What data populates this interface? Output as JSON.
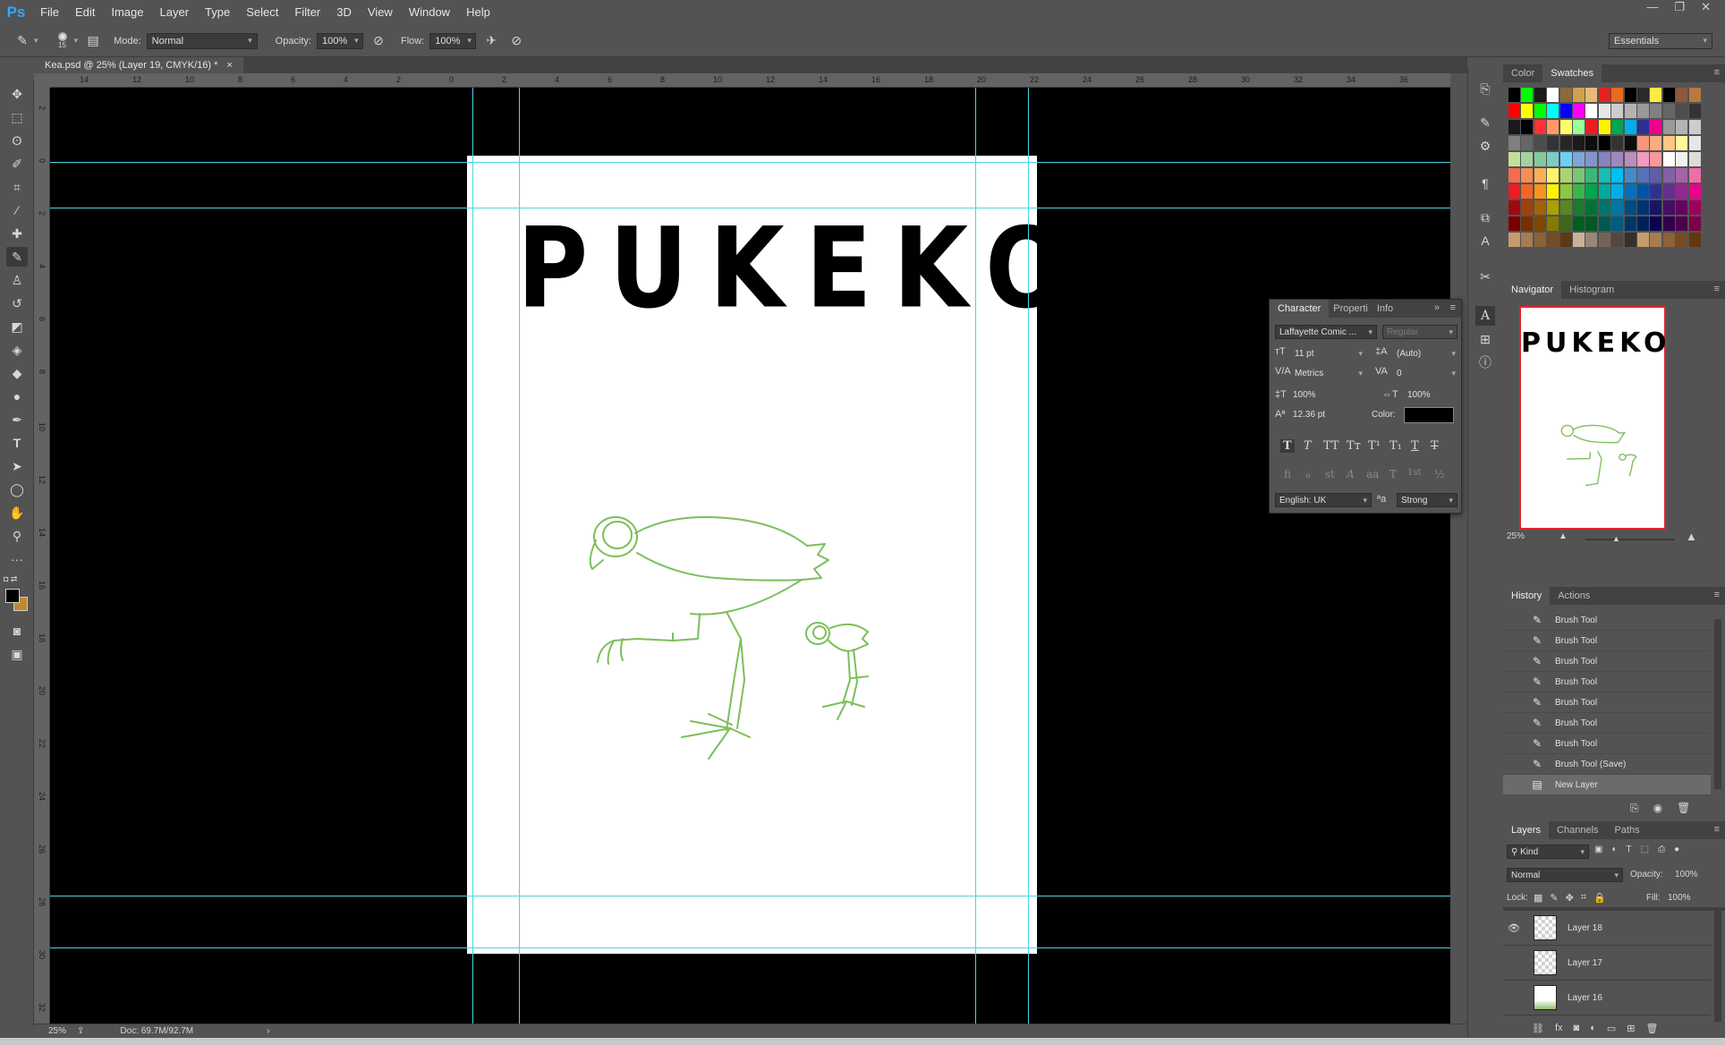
{
  "menubar": {
    "logo": "Ps",
    "items": [
      "File",
      "Edit",
      "Image",
      "Layer",
      "Type",
      "Select",
      "Filter",
      "3D",
      "View",
      "Window",
      "Help"
    ]
  },
  "options": {
    "brush_size": "15",
    "mode_label": "Mode:",
    "mode_value": "Normal",
    "opacity_label": "Opacity:",
    "opacity_value": "100%",
    "flow_label": "Flow:",
    "flow_value": "100%",
    "workspace": "Essentials"
  },
  "document": {
    "tab_title": "Kea.psd @ 25% (Layer 19, CMYK/16) *",
    "headline": "PUKEKO",
    "illustration": "green pukeko sketch",
    "guide_color": "#4fd3e6",
    "sketch_color": "#7cbf5a"
  },
  "rulers": {
    "top": [
      "14",
      "12",
      "10",
      "8",
      "6",
      "4",
      "2",
      "0",
      "2",
      "4",
      "6",
      "8",
      "10",
      "12",
      "14",
      "16",
      "18",
      "20",
      "22",
      "24",
      "26",
      "28",
      "30",
      "32",
      "34",
      "36"
    ],
    "left": [
      "2",
      "0",
      "2",
      "4",
      "6",
      "8",
      "10",
      "12",
      "14",
      "16",
      "18",
      "20",
      "22",
      "24",
      "26",
      "28",
      "30",
      "32"
    ]
  },
  "statusbar": {
    "zoom": "25%",
    "doc_info": "Doc: 69.7M/92.7M"
  },
  "panels": {
    "color_tabs": [
      "Color",
      "Swatches"
    ],
    "navigator_tabs": [
      "Navigator",
      "Histogram"
    ],
    "navigator_zoom": "25%",
    "history_tabs": [
      "History",
      "Actions"
    ],
    "history_items": [
      "Brush Tool",
      "Brush Tool",
      "Brush Tool",
      "Brush Tool",
      "Brush Tool",
      "Brush Tool",
      "Brush Tool",
      "Brush Tool (Save)",
      "New Layer"
    ],
    "layers_tabs": [
      "Layers",
      "Channels",
      "Paths"
    ],
    "layers_filter": "Kind",
    "blend_mode": "Normal",
    "opacity_label": "Opacity:",
    "opacity_value": "100%",
    "lock_label": "Lock:",
    "fill_label": "Fill:",
    "fill_value": "100%",
    "layers": [
      {
        "name": "Layer 18",
        "visible": true
      },
      {
        "name": "Layer 17",
        "visible": false
      },
      {
        "name": "Layer 16",
        "visible": false
      }
    ]
  },
  "character": {
    "tabs": [
      "Character",
      "Properti",
      "Info"
    ],
    "font_family": "Laffayette Comic ...",
    "font_style": "Regular",
    "size": "11 pt",
    "leading": "(Auto)",
    "kerning": "Metrics",
    "tracking": "0",
    "vscale": "100%",
    "hscale": "100%",
    "baseline": "12.36 pt",
    "color_label": "Color:",
    "color_value": "#000000",
    "language": "English: UK",
    "antialias": "Strong",
    "style_buttons": [
      "T",
      "T",
      "TT",
      "Tт",
      "T¹",
      "T₁",
      "T",
      "T"
    ],
    "opentype_buttons": [
      "fi",
      "ℴ",
      "st",
      "A",
      "aa",
      "T",
      "1st",
      "½"
    ]
  },
  "swatch_colors": [
    [
      "#000000",
      "#00ff00",
      "#1a1a1a",
      "#ffffff",
      "#8c6a3a",
      "#d2a04c",
      "#e8b878",
      "#e62020",
      "#e66b1e",
      "#000000",
      "#2a2a2a",
      "#ffe84a",
      "#000000",
      "#8c5a3a",
      "#b87840"
    ],
    [
      "#ff0000",
      "#ffff00",
      "#00ff00",
      "#00ffff",
      "#0000ff",
      "#ff00ff",
      "#ffffff",
      "#e6e6e6",
      "#cccccc",
      "#b3b3b3",
      "#999999",
      "#808080",
      "#666666",
      "#4d4d4d",
      "#333333"
    ],
    [
      "#1a1a1a",
      "#000000",
      "#ff3333",
      "#ff9966",
      "#ffff66",
      "#99ff99",
      "#ed1c24",
      "#fff200",
      "#00a651",
      "#00aeef",
      "#2e3192",
      "#ec008c",
      "#999999",
      "#b3b3b3",
      "#cccccc"
    ],
    [
      "#808080",
      "#666666",
      "#4d4d4d",
      "#333333",
      "#262626",
      "#1a1a1a",
      "#0d0d0d",
      "#000000",
      "#333333",
      "#0d0d0d",
      "#f7977a",
      "#f9ad81",
      "#fdc68a",
      "#fff79a",
      "#e6e6e6"
    ],
    [
      "#c4df9b",
      "#a3d39c",
      "#82ca9d",
      "#7bcdc8",
      "#6ecff6",
      "#7ea7d8",
      "#8493ca",
      "#8882be",
      "#a187be",
      "#bc8dbf",
      "#f49ac2",
      "#f6989d",
      "#ffffff",
      "#f0f0f0",
      "#dcdcdc"
    ],
    [
      "#f26c4f",
      "#f68e55",
      "#fbaf5c",
      "#fff467",
      "#acd372",
      "#7cc576",
      "#3bb878",
      "#1abbb4",
      "#00bff3",
      "#438ccb",
      "#5574b9",
      "#605ca8",
      "#855fa8",
      "#a763a8",
      "#f06ea9"
    ],
    [
      "#ed1c24",
      "#f26522",
      "#f7941d",
      "#fff200",
      "#8dc63f",
      "#39b54a",
      "#00a651",
      "#00a99d",
      "#00aeef",
      "#0072bc",
      "#0054a6",
      "#2e3192",
      "#662d91",
      "#92278f",
      "#ec008c"
    ],
    [
      "#9e0b0f",
      "#a0410d",
      "#a3620a",
      "#aba000",
      "#598527",
      "#1a7b30",
      "#007236",
      "#00746b",
      "#0076a3",
      "#004b80",
      "#003471",
      "#1b1464",
      "#440e62",
      "#630460",
      "#9e005d"
    ],
    [
      "#790000",
      "#7b2e00",
      "#7d4900",
      "#827b00",
      "#406618",
      "#005e20",
      "#005826",
      "#005952",
      "#005b7f",
      "#003663",
      "#002157",
      "#0d004c",
      "#32004b",
      "#4b0049",
      "#7b0046"
    ],
    [
      "#c69c6d",
      "#a67c52",
      "#8c6239",
      "#754c24",
      "#603813",
      "#c7b299",
      "#998675",
      "#736357",
      "#534741",
      "#37302a",
      "#c69c6d",
      "#a67c52",
      "#8c6239",
      "#754c24",
      "#603813"
    ]
  ]
}
